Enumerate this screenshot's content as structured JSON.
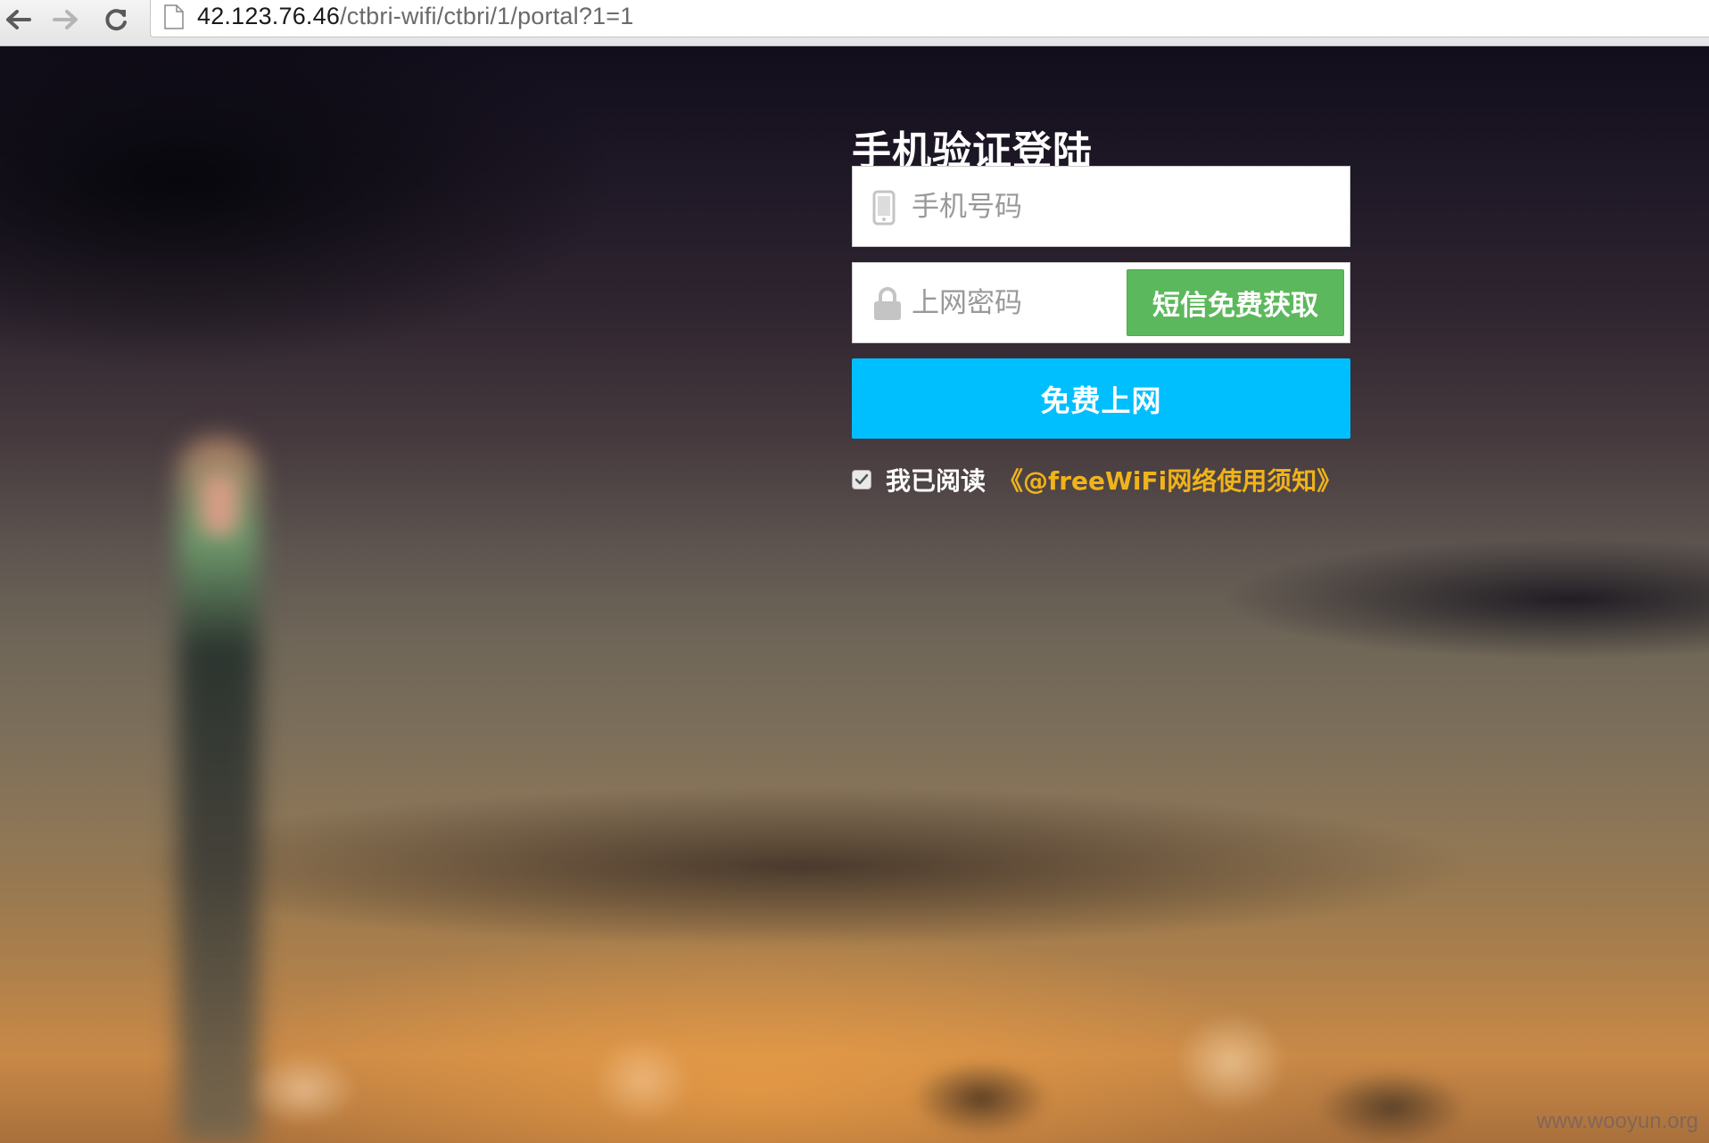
{
  "browser": {
    "url_host": "42.123.76.46",
    "url_path": "/ctbri-wifi/ctbri/1/portal?1=1",
    "icons": {
      "back": "back-arrow-icon",
      "forward": "forward-arrow-icon",
      "reload": "reload-icon",
      "page": "page-icon"
    }
  },
  "login": {
    "title": "手机验证登陆",
    "phone_placeholder": "手机号码",
    "password_placeholder": "上网密码",
    "sms_button": "短信免费获取",
    "submit_button": "免费上网",
    "agree_checked": true,
    "agree_text": "我已阅读",
    "agree_link": "《@freeWiFi网络使用须知》"
  },
  "watermark": "www.wooyun.org",
  "colors": {
    "sms_button": "#5cb85c",
    "submit_button": "#00bfff",
    "agree_link": "#f0b31a"
  }
}
